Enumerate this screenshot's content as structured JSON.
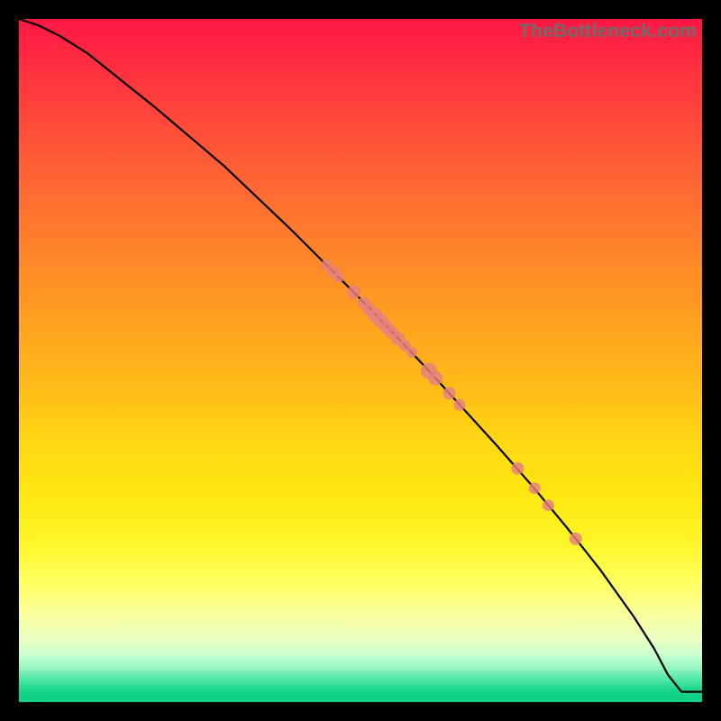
{
  "watermark": "TheBottleneck.com",
  "chart_data": {
    "type": "line",
    "title": "",
    "xlabel": "",
    "ylabel": "",
    "xlim": [
      0,
      100
    ],
    "ylim": [
      0,
      100
    ],
    "curve": {
      "x": [
        0,
        3,
        6,
        10,
        14,
        20,
        30,
        40,
        45,
        50,
        55,
        60,
        65,
        70,
        75,
        80,
        85,
        90,
        93,
        95,
        97,
        100
      ],
      "y": [
        100,
        99,
        97.5,
        95,
        91.8,
        87,
        78.5,
        69,
        64,
        59,
        53.8,
        48.5,
        43,
        37.5,
        31.8,
        25.8,
        19.5,
        12.5,
        7.8,
        4,
        1.5,
        1.5
      ]
    },
    "points": {
      "x": [
        45.0,
        46.0,
        46.8,
        49.0,
        50.5,
        51.3,
        52.2,
        53.0,
        53.8,
        54.6,
        55.5,
        56.5,
        57.5,
        60.0,
        61.0,
        63.0,
        64.5,
        73.0,
        75.5,
        77.5,
        81.5
      ],
      "y": [
        64.0,
        63.0,
        62.2,
        60.0,
        58.4,
        57.5,
        56.6,
        55.8,
        54.9,
        54.1,
        53.2,
        52.2,
        51.2,
        48.5,
        47.4,
        45.2,
        43.5,
        34.2,
        31.3,
        28.8,
        23.9
      ],
      "r": [
        6.0,
        7.0,
        6.0,
        7.5,
        7.0,
        7.5,
        8.0,
        8.0,
        7.5,
        7.0,
        7.5,
        6.5,
        6.0,
        9.0,
        8.0,
        7.0,
        6.5,
        7.0,
        6.5,
        6.5,
        7.0
      ]
    },
    "gradient_stops": [
      {
        "pos": 0.0,
        "color": "#ff1744"
      },
      {
        "pos": 0.5,
        "color": "#ffc107"
      },
      {
        "pos": 0.85,
        "color": "#fff176"
      },
      {
        "pos": 1.0,
        "color": "#0ecf85"
      }
    ]
  }
}
